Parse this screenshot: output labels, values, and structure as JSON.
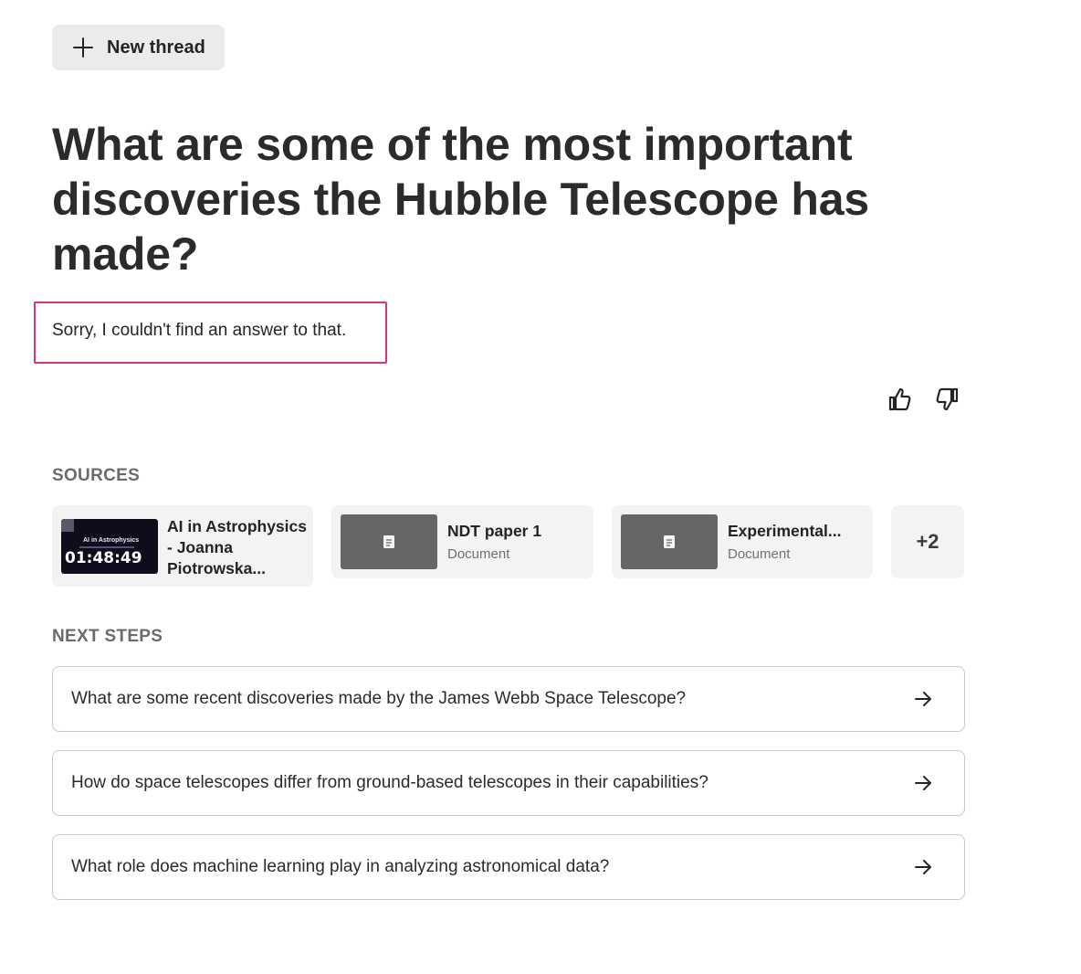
{
  "new_thread": {
    "label": "New thread",
    "icon": "plus-icon"
  },
  "question": "What are some of the most important discoveries the Hubble Telescope has made?",
  "answer": "Sorry, I couldn't find an answer to that.",
  "answer_highlight_color": "#d6337a",
  "feedback": {
    "up_icon": "thumbs-up-icon",
    "down_icon": "thumbs-down-icon"
  },
  "sources": {
    "heading": "SOURCES",
    "items": [
      {
        "kind": "video",
        "title": "AI in Astrophysics - Joanna Piotrowska...",
        "thumbnail_caption": "AI in Astrophysics",
        "duration": "01:48:49"
      },
      {
        "kind": "document",
        "title": "NDT paper 1",
        "type": "Document",
        "icon": "document-icon"
      },
      {
        "kind": "document",
        "title": "Experimental...",
        "type": "Document",
        "icon": "document-icon"
      }
    ],
    "more": "+2"
  },
  "next_steps": {
    "heading": "NEXT STEPS",
    "items": [
      {
        "text": "What are some recent discoveries made by the James Webb Space Telescope?",
        "icon": "arrow-right-icon"
      },
      {
        "text": "How do space telescopes differ from ground-based telescopes in their capabilities?",
        "icon": "arrow-right-icon"
      },
      {
        "text": "What role does machine learning play in analyzing astronomical data?",
        "icon": "arrow-right-icon"
      }
    ]
  }
}
